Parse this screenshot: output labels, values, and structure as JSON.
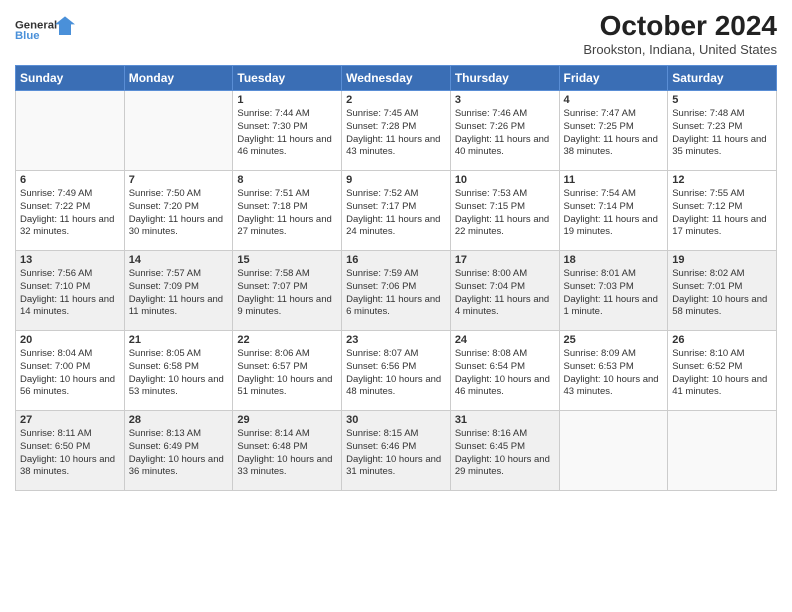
{
  "header": {
    "logo": {
      "line1": "General",
      "line2": "Blue"
    },
    "title": "October 2024",
    "subtitle": "Brookston, Indiana, United States"
  },
  "weekdays": [
    "Sunday",
    "Monday",
    "Tuesday",
    "Wednesday",
    "Thursday",
    "Friday",
    "Saturday"
  ],
  "weeks": [
    [
      {
        "day": "",
        "info": ""
      },
      {
        "day": "",
        "info": ""
      },
      {
        "day": "1",
        "info": "Sunrise: 7:44 AM\nSunset: 7:30 PM\nDaylight: 11 hours and 46 minutes."
      },
      {
        "day": "2",
        "info": "Sunrise: 7:45 AM\nSunset: 7:28 PM\nDaylight: 11 hours and 43 minutes."
      },
      {
        "day": "3",
        "info": "Sunrise: 7:46 AM\nSunset: 7:26 PM\nDaylight: 11 hours and 40 minutes."
      },
      {
        "day": "4",
        "info": "Sunrise: 7:47 AM\nSunset: 7:25 PM\nDaylight: 11 hours and 38 minutes."
      },
      {
        "day": "5",
        "info": "Sunrise: 7:48 AM\nSunset: 7:23 PM\nDaylight: 11 hours and 35 minutes."
      }
    ],
    [
      {
        "day": "6",
        "info": "Sunrise: 7:49 AM\nSunset: 7:22 PM\nDaylight: 11 hours and 32 minutes."
      },
      {
        "day": "7",
        "info": "Sunrise: 7:50 AM\nSunset: 7:20 PM\nDaylight: 11 hours and 30 minutes."
      },
      {
        "day": "8",
        "info": "Sunrise: 7:51 AM\nSunset: 7:18 PM\nDaylight: 11 hours and 27 minutes."
      },
      {
        "day": "9",
        "info": "Sunrise: 7:52 AM\nSunset: 7:17 PM\nDaylight: 11 hours and 24 minutes."
      },
      {
        "day": "10",
        "info": "Sunrise: 7:53 AM\nSunset: 7:15 PM\nDaylight: 11 hours and 22 minutes."
      },
      {
        "day": "11",
        "info": "Sunrise: 7:54 AM\nSunset: 7:14 PM\nDaylight: 11 hours and 19 minutes."
      },
      {
        "day": "12",
        "info": "Sunrise: 7:55 AM\nSunset: 7:12 PM\nDaylight: 11 hours and 17 minutes."
      }
    ],
    [
      {
        "day": "13",
        "info": "Sunrise: 7:56 AM\nSunset: 7:10 PM\nDaylight: 11 hours and 14 minutes."
      },
      {
        "day": "14",
        "info": "Sunrise: 7:57 AM\nSunset: 7:09 PM\nDaylight: 11 hours and 11 minutes."
      },
      {
        "day": "15",
        "info": "Sunrise: 7:58 AM\nSunset: 7:07 PM\nDaylight: 11 hours and 9 minutes."
      },
      {
        "day": "16",
        "info": "Sunrise: 7:59 AM\nSunset: 7:06 PM\nDaylight: 11 hours and 6 minutes."
      },
      {
        "day": "17",
        "info": "Sunrise: 8:00 AM\nSunset: 7:04 PM\nDaylight: 11 hours and 4 minutes."
      },
      {
        "day": "18",
        "info": "Sunrise: 8:01 AM\nSunset: 7:03 PM\nDaylight: 11 hours and 1 minute."
      },
      {
        "day": "19",
        "info": "Sunrise: 8:02 AM\nSunset: 7:01 PM\nDaylight: 10 hours and 58 minutes."
      }
    ],
    [
      {
        "day": "20",
        "info": "Sunrise: 8:04 AM\nSunset: 7:00 PM\nDaylight: 10 hours and 56 minutes."
      },
      {
        "day": "21",
        "info": "Sunrise: 8:05 AM\nSunset: 6:58 PM\nDaylight: 10 hours and 53 minutes."
      },
      {
        "day": "22",
        "info": "Sunrise: 8:06 AM\nSunset: 6:57 PM\nDaylight: 10 hours and 51 minutes."
      },
      {
        "day": "23",
        "info": "Sunrise: 8:07 AM\nSunset: 6:56 PM\nDaylight: 10 hours and 48 minutes."
      },
      {
        "day": "24",
        "info": "Sunrise: 8:08 AM\nSunset: 6:54 PM\nDaylight: 10 hours and 46 minutes."
      },
      {
        "day": "25",
        "info": "Sunrise: 8:09 AM\nSunset: 6:53 PM\nDaylight: 10 hours and 43 minutes."
      },
      {
        "day": "26",
        "info": "Sunrise: 8:10 AM\nSunset: 6:52 PM\nDaylight: 10 hours and 41 minutes."
      }
    ],
    [
      {
        "day": "27",
        "info": "Sunrise: 8:11 AM\nSunset: 6:50 PM\nDaylight: 10 hours and 38 minutes."
      },
      {
        "day": "28",
        "info": "Sunrise: 8:13 AM\nSunset: 6:49 PM\nDaylight: 10 hours and 36 minutes."
      },
      {
        "day": "29",
        "info": "Sunrise: 8:14 AM\nSunset: 6:48 PM\nDaylight: 10 hours and 33 minutes."
      },
      {
        "day": "30",
        "info": "Sunrise: 8:15 AM\nSunset: 6:46 PM\nDaylight: 10 hours and 31 minutes."
      },
      {
        "day": "31",
        "info": "Sunrise: 8:16 AM\nSunset: 6:45 PM\nDaylight: 10 hours and 29 minutes."
      },
      {
        "day": "",
        "info": ""
      },
      {
        "day": "",
        "info": ""
      }
    ]
  ]
}
